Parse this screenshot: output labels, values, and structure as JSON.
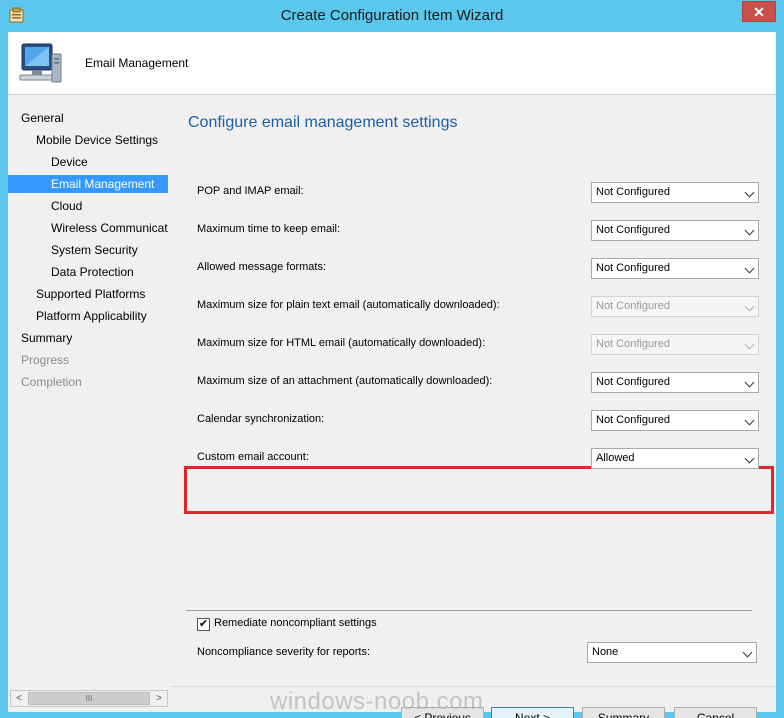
{
  "window": {
    "title": "Create Configuration Item Wizard",
    "close_glyph": "✕"
  },
  "header": {
    "title": "Email Management"
  },
  "nav": {
    "items": [
      {
        "label": "General",
        "state": "normal"
      },
      {
        "label": "Mobile Device Settings",
        "state": "normal"
      },
      {
        "label": "Device",
        "state": "normal"
      },
      {
        "label": "Email Management",
        "state": "selected"
      },
      {
        "label": "Cloud",
        "state": "normal"
      },
      {
        "label": "Wireless Communications",
        "state": "normal"
      },
      {
        "label": "System Security",
        "state": "normal"
      },
      {
        "label": "Data Protection",
        "state": "normal"
      },
      {
        "label": "Supported Platforms",
        "state": "normal"
      },
      {
        "label": "Platform Applicability",
        "state": "normal"
      },
      {
        "label": "Summary",
        "state": "normal"
      },
      {
        "label": "Progress",
        "state": "disabled"
      },
      {
        "label": "Completion",
        "state": "disabled"
      }
    ],
    "scroll_left": "<",
    "scroll_right": ">",
    "scroll_grip": "III"
  },
  "main": {
    "heading": "Configure email management settings",
    "settings": [
      {
        "label": "POP and IMAP email:",
        "value": "Not Configured",
        "enabled": true
      },
      {
        "label": "Maximum time to keep email:",
        "value": "Not Configured",
        "enabled": true
      },
      {
        "label": "Allowed message formats:",
        "value": "Not Configured",
        "enabled": true
      },
      {
        "label": "Maximum size for plain text email (automatically downloaded):",
        "value": "Not Configured",
        "enabled": false
      },
      {
        "label": "Maximum size for HTML email (automatically downloaded):",
        "value": "Not Configured",
        "enabled": false
      },
      {
        "label": "Maximum size of an attachment (automatically downloaded):",
        "value": "Not Configured",
        "enabled": true
      },
      {
        "label": "Calendar synchronization:",
        "value": "Not Configured",
        "enabled": true
      },
      {
        "label": "Custom email account:",
        "value": "Allowed",
        "enabled": true
      }
    ],
    "remediate": {
      "label": "Remediate noncompliant settings",
      "checked": "✔"
    },
    "severity": {
      "label": "Noncompliance severity for reports:",
      "value": "None"
    }
  },
  "buttons": {
    "previous": "< Previous",
    "next": "Next >",
    "summary": "Summary",
    "cancel": "Cancel"
  },
  "watermark": "windows-noob.com",
  "colors": {
    "title_bar": "#5bc7ec",
    "selected_nav": "#3399ff",
    "heading": "#1c5fa8",
    "highlight": "#e0252c"
  }
}
